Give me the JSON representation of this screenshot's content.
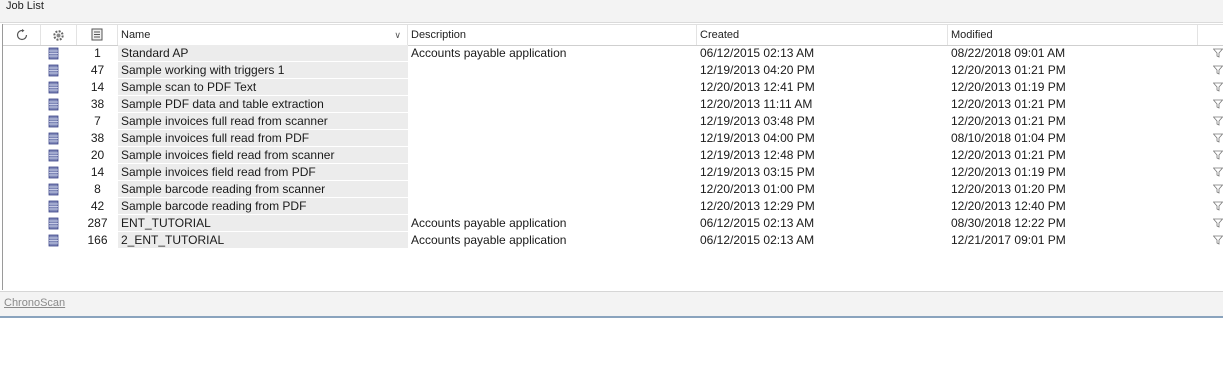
{
  "panel": {
    "title": "Job List"
  },
  "columns": {
    "name": "Name",
    "description": "Description",
    "created": "Created",
    "modified": "Modified"
  },
  "icons": {
    "header_col1": "refresh-icon",
    "header_col2": "settings-gear-icon",
    "header_col3": "document-count-icon",
    "row_icon": "database-icon",
    "row_action": "filter-funnel-icon"
  },
  "rows": [
    {
      "count": "1",
      "name": "Standard AP",
      "description": "Accounts payable application",
      "created": "06/12/2015 02:13 AM",
      "modified": "08/22/2018 09:01 AM"
    },
    {
      "count": "47",
      "name": "Sample working with triggers 1",
      "description": "",
      "created": "12/19/2013 04:20 PM",
      "modified": "12/20/2013 01:21 PM"
    },
    {
      "count": "14",
      "name": "Sample scan to PDF Text",
      "description": "",
      "created": "12/20/2013 12:41 PM",
      "modified": "12/20/2013 01:19 PM"
    },
    {
      "count": "38",
      "name": "Sample PDF data and table extraction",
      "description": "",
      "created": "12/20/2013 11:11 AM",
      "modified": "12/20/2013 01:21 PM"
    },
    {
      "count": "7",
      "name": "Sample invoices full read from scanner",
      "description": "",
      "created": "12/19/2013 03:48 PM",
      "modified": "12/20/2013 01:21 PM"
    },
    {
      "count": "38",
      "name": "Sample invoices full read from PDF",
      "description": "",
      "created": "12/19/2013 04:00 PM",
      "modified": "08/10/2018 01:04 PM"
    },
    {
      "count": "20",
      "name": "Sample invoices field read from scanner",
      "description": "",
      "created": "12/19/2013 12:48 PM",
      "modified": "12/20/2013 01:21 PM"
    },
    {
      "count": "14",
      "name": "Sample invoices field read from PDF",
      "description": "",
      "created": "12/19/2013 03:15 PM",
      "modified": "12/20/2013 01:19 PM"
    },
    {
      "count": "8",
      "name": "Sample barcode reading from scanner",
      "description": "",
      "created": "12/20/2013 01:00 PM",
      "modified": "12/20/2013 01:20 PM"
    },
    {
      "count": "42",
      "name": "Sample barcode reading from PDF",
      "description": "",
      "created": "12/20/2013 12:29 PM",
      "modified": "12/20/2013 12:40 PM"
    },
    {
      "count": "287",
      "name": "ENT_TUTORIAL",
      "description": "Accounts payable application",
      "created": "06/12/2015 02:13 AM",
      "modified": "08/30/2018 12:22 PM"
    },
    {
      "count": "166",
      "name": "2_ENT_TUTORIAL",
      "description": "Accounts payable application",
      "created": "06/12/2015 02:13 AM",
      "modified": "12/21/2017 09:01 PM"
    }
  ],
  "footer": {
    "link_label": "ChronoScan"
  },
  "colors": {
    "name_column_bg": "#ececec",
    "accent_border": "#8aa3bd"
  }
}
